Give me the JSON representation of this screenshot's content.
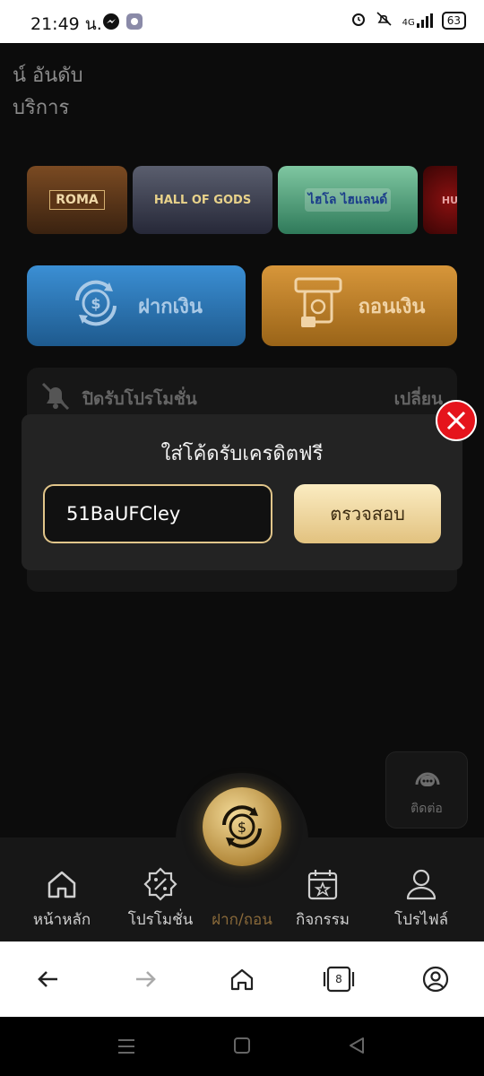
{
  "status_bar": {
    "time": "21:49 น.",
    "battery": "63",
    "network": "4G"
  },
  "header": {
    "line1": "น์ อันดับ",
    "line2": "บริการ"
  },
  "games": [
    {
      "name": "ROMA"
    },
    {
      "name": "HALL OF GODS"
    },
    {
      "name": "ไฮโล ไฮแลนด์"
    },
    {
      "name": "HU"
    }
  ],
  "actions": {
    "deposit_label": "ฝากเงิน",
    "withdraw_label": "ถอนเงิน"
  },
  "promo": {
    "label": "ปิดรับโปรโมชั่น",
    "change": "เปลี่ยน"
  },
  "modal": {
    "title": "ใส่โค้ดรับเครดิตฟรี",
    "code_value": "51BaUFCley",
    "check_label": "ตรวจสอบ"
  },
  "contact": {
    "label": "ติดต่อ"
  },
  "bottom_nav": {
    "items": [
      {
        "label": "หน้าหลัก",
        "icon": "home-icon"
      },
      {
        "label": "โปรโมชั่น",
        "icon": "promotion-icon"
      },
      {
        "label": "ฝาก/ถอน",
        "icon": "exchange-icon"
      },
      {
        "label": "กิจกรรม",
        "icon": "calendar-icon"
      },
      {
        "label": "โปรไฟล์",
        "icon": "profile-icon"
      }
    ]
  },
  "browser": {
    "tab_count": "8"
  },
  "colors": {
    "accent_gold": "#e2c27f",
    "deposit_blue": "#2a73b5",
    "withdraw_orange": "#c07e25",
    "close_red": "#e5141c"
  }
}
